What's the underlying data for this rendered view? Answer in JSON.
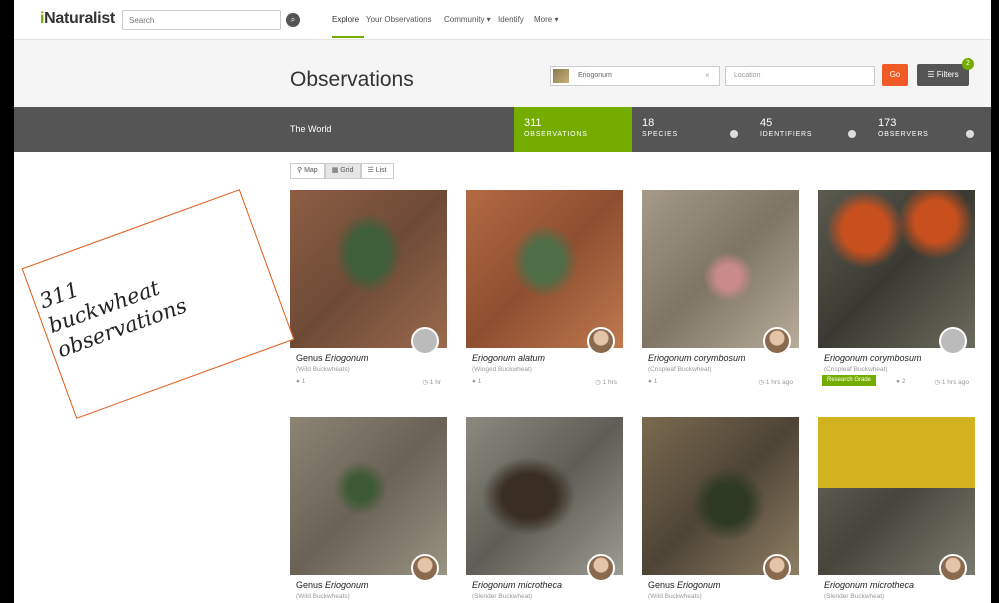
{
  "app": {
    "logo": "iNaturalist",
    "search_placeholder": "Search"
  },
  "nav": {
    "explore": "Explore",
    "your_observations": "Your Observations",
    "community": "Community ▾",
    "identify": "Identify",
    "more": "More ▾"
  },
  "header": {
    "title": "Observations",
    "taxon_value": "Eriogonum",
    "location_placeholder": "Location",
    "go_label": "Go",
    "filters_label": "☰ Filters",
    "filters_count": "2"
  },
  "stats": {
    "place": "The World",
    "observations": {
      "value": "311",
      "label": "OBSERVATIONS"
    },
    "species": {
      "value": "18",
      "label": "SPECIES"
    },
    "identifiers": {
      "value": "45",
      "label": "IDENTIFIERS"
    },
    "observers": {
      "value": "173",
      "label": "OBSERVERS"
    }
  },
  "views": {
    "map": "⚲ Map",
    "grid": "▦ Grid",
    "list": "☰ List",
    "selected": "grid"
  },
  "cards": [
    {
      "rank": "Genus",
      "name": "Eriogonum",
      "common": "(Wild Buckwheats)",
      "ids": "1",
      "time": "1 hr",
      "quality": ""
    },
    {
      "rank": "",
      "name": "Eriogonum alatum",
      "common": "(Winged Buckwheat)",
      "ids": "1",
      "time": "1 hrs",
      "quality": ""
    },
    {
      "rank": "",
      "name": "Eriogonum corymbosum",
      "common": "(Crispleaf Buckwheat)",
      "ids": "1",
      "time": "1 hrs ago",
      "quality": ""
    },
    {
      "rank": "",
      "name": "Eriogonum corymbosum",
      "common": "(Crispleaf Buckwheat)",
      "ids": "2",
      "time": "1 hrs ago",
      "quality": "Research Grade"
    },
    {
      "rank": "Genus",
      "name": "Eriogonum",
      "common": "(Wild Buckwheats)",
      "ids": "",
      "time": "",
      "quality": ""
    },
    {
      "rank": "",
      "name": "Eriogonum microtheca",
      "common": "(Slender Buckwheat)",
      "ids": "",
      "time": "",
      "quality": ""
    },
    {
      "rank": "Genus",
      "name": "Eriogonum",
      "common": "(Wild Buckwheats)",
      "ids": "",
      "time": "",
      "quality": ""
    },
    {
      "rank": "",
      "name": "Eriogonum microtheca",
      "common": "(Slender Buckwheat)",
      "ids": "",
      "time": "",
      "quality": ""
    }
  ],
  "annotation": {
    "text": "311\nbuckwheat\nobservations"
  },
  "colors": {
    "brand_green": "#74ac00",
    "go_orange": "#f05a24",
    "stats_bar": "#555555",
    "annotation_border": "#e05a18"
  }
}
